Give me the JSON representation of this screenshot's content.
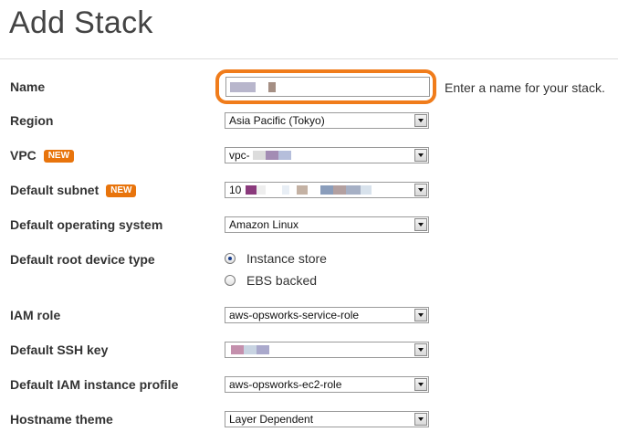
{
  "page": {
    "title": "Add Stack"
  },
  "form": {
    "name": {
      "label": "Name",
      "value": "",
      "hint": "Enter a name for your stack."
    },
    "region": {
      "label": "Region",
      "value": "Asia Pacific (Tokyo)"
    },
    "vpc": {
      "label": "VPC",
      "badge": "NEW",
      "value": "vpc-"
    },
    "default_subnet": {
      "label": "Default subnet",
      "badge": "NEW",
      "value": "10"
    },
    "default_os": {
      "label": "Default operating system",
      "value": "Amazon Linux"
    },
    "root_device": {
      "label": "Default root device type",
      "options": [
        {
          "label": "Instance store",
          "checked": true
        },
        {
          "label": "EBS backed",
          "checked": false
        }
      ]
    },
    "iam_role": {
      "label": "IAM role",
      "value": "aws-opsworks-service-role"
    },
    "ssh_key": {
      "label": "Default SSH key",
      "value": ""
    },
    "iam_profile": {
      "label": "Default IAM instance profile",
      "value": "aws-opsworks-ec2-role"
    },
    "hostname_theme": {
      "label": "Hostname theme",
      "value": "Layer Dependent"
    }
  },
  "colors": {
    "badge": "#e8740c",
    "highlight": "#f07c1b"
  }
}
